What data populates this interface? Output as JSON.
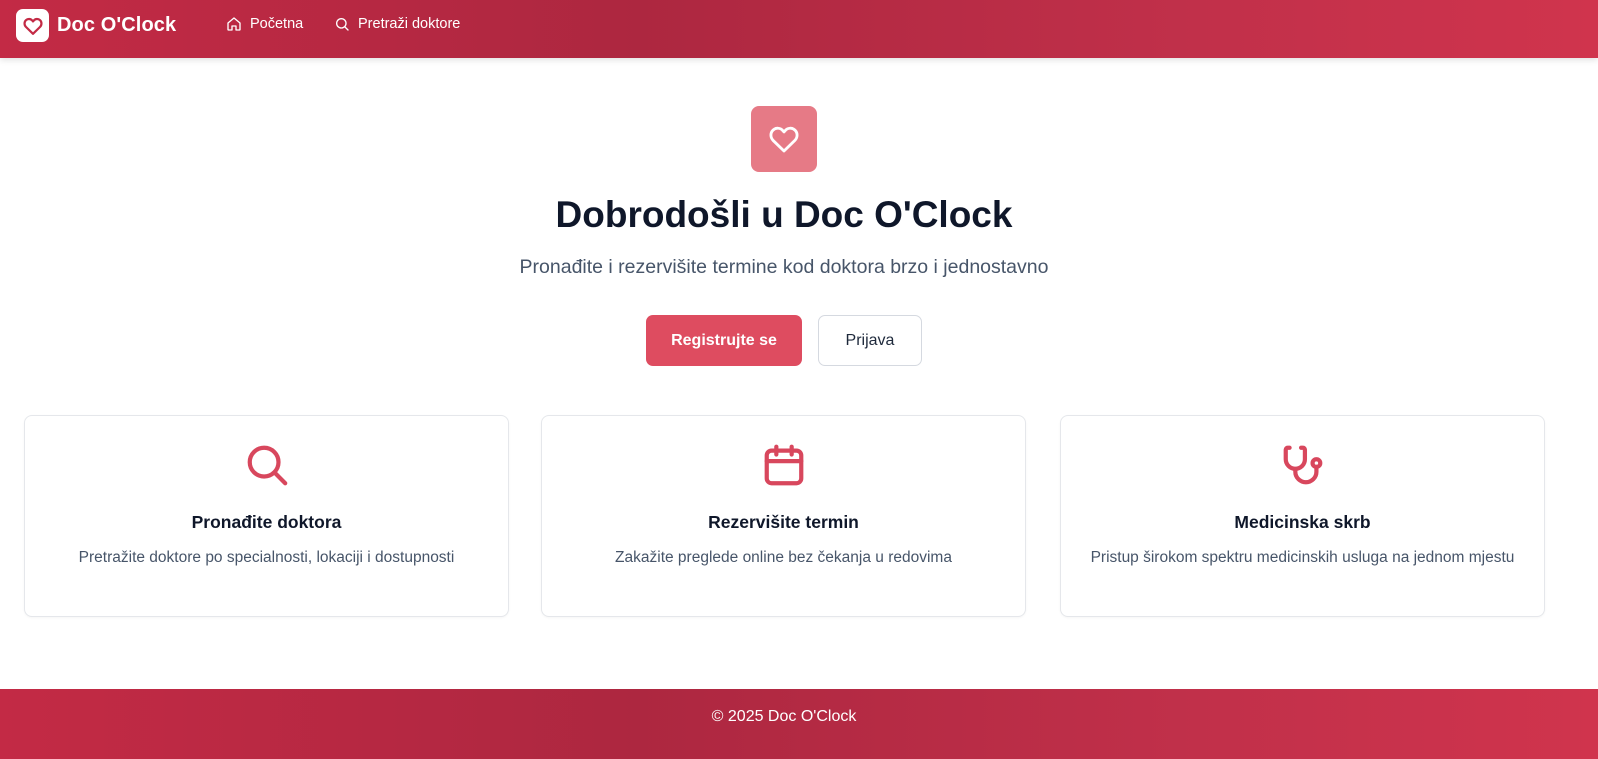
{
  "navbar": {
    "brand": "Doc O'Clock",
    "links": [
      {
        "label": "Početna",
        "icon": "home-icon"
      },
      {
        "label": "Pretraži doktore",
        "icon": "search-icon"
      }
    ]
  },
  "hero": {
    "icon": "heart-icon",
    "title": "Dobrodošli u Doc O'Clock",
    "subtitle": "Pronađite i rezervišite termine kod doktora brzo i jednostavno",
    "primary_button": "Registrujte se",
    "secondary_button": "Prijava"
  },
  "features": [
    {
      "icon": "search-icon",
      "title": "Pronađite doktora",
      "description": "Pretražite doktore po specialnosti, lokaciji i dostupnosti"
    },
    {
      "icon": "calendar-icon",
      "title": "Rezervišite termin",
      "description": "Zakažite preglede online bez čekanja u redovima"
    },
    {
      "icon": "stethoscope-icon",
      "title": "Medicinska skrb",
      "description": "Pristup širokom spektru medicinskih usluga na jednom mjestu"
    }
  ],
  "footer": {
    "text": "© 2025 Doc O'Clock"
  },
  "colors": {
    "brand": "#c32a45",
    "accent": "#de4c60",
    "hero_icon_bg": "#e67a86"
  }
}
